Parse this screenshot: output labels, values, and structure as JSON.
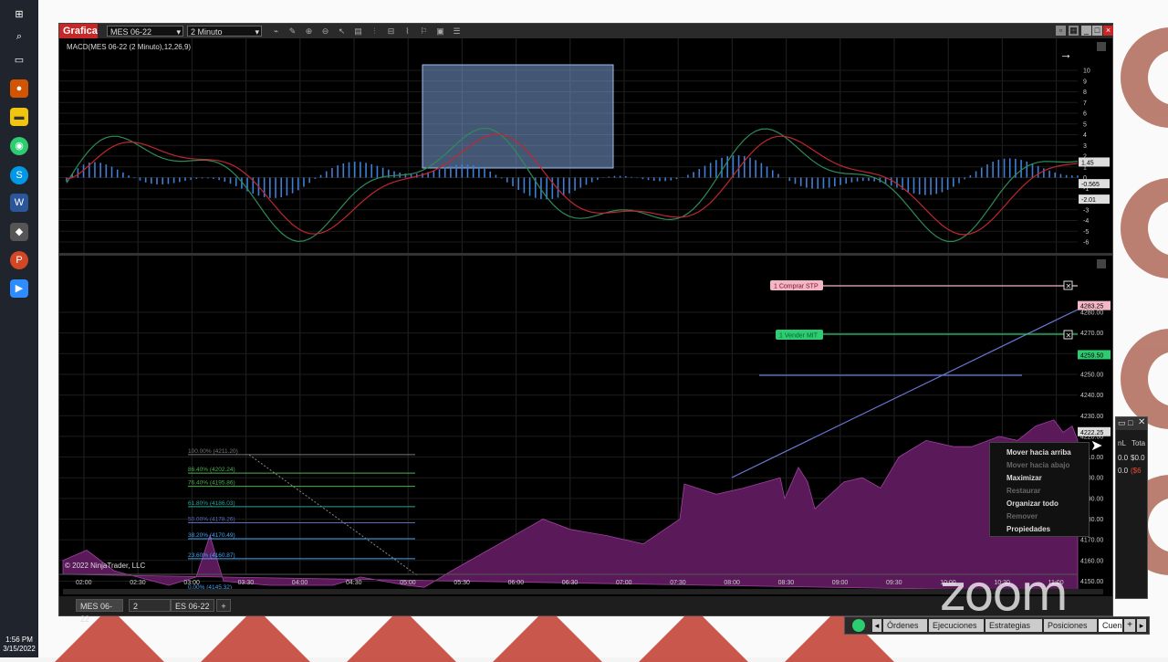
{
  "taskbar": {
    "icons": [
      "windows-icon",
      "search-icon",
      "task-view-icon",
      "paint-icon",
      "file-explorer-icon",
      "chrome-icon",
      "skype-icon",
      "word-icon",
      "app-icon",
      "powerpoint-icon",
      "zoom-icon"
    ],
    "time": "1:56 PM",
    "date": "3/15/2022"
  },
  "window": {
    "title": "Grafica",
    "instrument": "MES 06-22",
    "interval": "2 Minuto",
    "indicator_label": "MACD(MES 06-22 (2 Minuto),12,26,9)",
    "copyright": "© 2022 NinjaTrader, LLC"
  },
  "macd_axis": [
    "10",
    "9",
    "8",
    "7",
    "6",
    "5",
    "4",
    "3",
    "2",
    "1",
    "0",
    "-1",
    "-2",
    "-3",
    "-4",
    "-5",
    "-6"
  ],
  "macd_badges": [
    "1.45",
    "-0.565",
    "-2.01"
  ],
  "price_axis": [
    "4280.00",
    "4270.00",
    "4260.00",
    "4250.00",
    "4240.00",
    "4230.00",
    "4220.00",
    "4210.00",
    "4200.00",
    "4190.00",
    "4180.00",
    "4170.00",
    "4160.00",
    "4150.00"
  ],
  "price_badges": {
    "buy": "4283.25",
    "sell": "4259.50",
    "last": "4222.25"
  },
  "orders": {
    "buy": "1  Comprar STP",
    "sell": "1  Vender MIT"
  },
  "time_axis": [
    "02:00",
    "02:30",
    "03:00",
    "03:30",
    "04:00",
    "04:30",
    "05:00",
    "05:30",
    "06:00",
    "06:30",
    "07:00",
    "07:30",
    "08:00",
    "08:30",
    "09:00",
    "09:30",
    "10:00",
    "10:30",
    "11:00"
  ],
  "fib_levels": [
    "100.00% (4211.20)",
    "86.40% (4202.24)",
    "76.40% (4195.86)",
    "61.80% (4186.03)",
    "50.00% (4178.26)",
    "38.20% (4170.49)",
    "23.60% (4160.87)",
    "0.00% (4145.32)"
  ],
  "bottom_tabs": [
    "MES 06-22",
    "2",
    "ES 06-22",
    "+"
  ],
  "context_menu": [
    {
      "label": "Mover hacia arriba",
      "enabled": true
    },
    {
      "label": "Mover hacia abajo",
      "enabled": false
    },
    {
      "label": "Maximizar",
      "enabled": true
    },
    {
      "label": "Restaurar",
      "enabled": false
    },
    {
      "label": "Organizar todo",
      "enabled": true
    },
    {
      "label": "Remover",
      "enabled": false
    },
    {
      "label": "Propiedades",
      "enabled": true
    }
  ],
  "side_window": {
    "col1": "nL",
    "col2": "Tota",
    "rows": [
      [
        "0.0",
        "$0.0"
      ],
      [
        "0.0",
        "($6"
      ]
    ]
  },
  "control_tabs": [
    "Órdenes",
    "Ejecuciones",
    "Estrategias",
    "Posiciones",
    "Cuen"
  ],
  "watermark": "zoom",
  "colors": {
    "accent": "#c62828",
    "price_fill": "#5a1a5a",
    "buy_line": "#f3b6c4",
    "sell_line": "#2ecc71",
    "macd_line": "#2e8b57",
    "signal_line": "#c0272d",
    "hist": "#3f7fd6"
  }
}
